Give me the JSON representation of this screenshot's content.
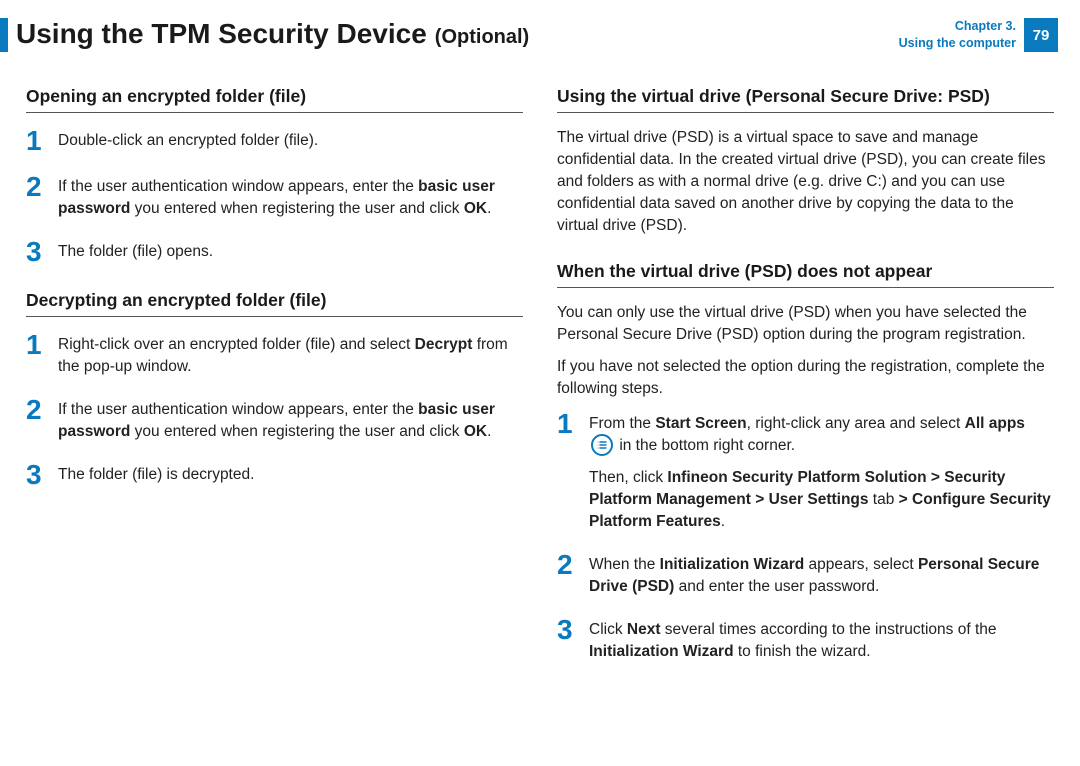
{
  "header": {
    "title": "Using the TPM Security Device",
    "optional": "(Optional)",
    "chapter_line1": "Chapter 3.",
    "chapter_line2": "Using the computer",
    "page_number": "79"
  },
  "left": {
    "sec1_heading": "Opening an encrypted folder (file)",
    "sec1_step1": "Double-click an encrypted folder (file).",
    "sec1_step2_a": "If the user authentication window appears, enter the ",
    "sec1_step2_b": "basic user password",
    "sec1_step2_c": " you entered when registering the user and click ",
    "sec1_step2_d": "OK",
    "sec1_step2_e": ".",
    "sec1_step3": "The folder (file) opens.",
    "sec2_heading": "Decrypting an encrypted folder (file)",
    "sec2_step1_a": "Right-click over an encrypted folder (file) and select ",
    "sec2_step1_b": "Decrypt",
    "sec2_step1_c": " from the pop-up window.",
    "sec2_step2_a": "If the user authentication window appears, enter the ",
    "sec2_step2_b": "basic user password",
    "sec2_step2_c": " you entered when registering the user and click ",
    "sec2_step2_d": "OK",
    "sec2_step2_e": ".",
    "sec2_step3": "The folder (file) is decrypted."
  },
  "right": {
    "sec1_heading": "Using the virtual drive (Personal Secure Drive: PSD)",
    "sec1_body": "The virtual drive (PSD) is a virtual space to save and manage confidential data. In the created virtual drive (PSD), you can create files and folders as with a normal drive (e.g. drive C:) and you can use confidential data saved on another drive by copying the data to the virtual drive (PSD).",
    "sec2_heading": "When the virtual drive (PSD) does not appear",
    "sec2_body1": "You can only use the virtual drive (PSD) when you have selected the Personal Secure Drive (PSD) option during the program registration.",
    "sec2_body2": " If you have not selected the option during the registration, complete the following steps.",
    "sec2_step1_a": "From the ",
    "sec2_step1_b": "Start Screen",
    "sec2_step1_c": ", right-click any area and select ",
    "sec2_step1_d": "All apps",
    "sec2_step1_e": " in the bottom right corner.",
    "sec2_step1_f": "Then, click ",
    "sec2_step1_g": "Infineon Security Platform Solution > Security Platform Management > User Settings",
    "sec2_step1_h": " tab ",
    "sec2_step1_i": "> Configure Security Platform Features",
    "sec2_step1_j": ".",
    "sec2_step2_a": "When the ",
    "sec2_step2_b": "Initialization Wizard",
    "sec2_step2_c": " appears, select ",
    "sec2_step2_d": "Personal Secure Drive (PSD)",
    "sec2_step2_e": " and enter the user password.",
    "sec2_step3_a": "Click ",
    "sec2_step3_b": "Next",
    "sec2_step3_c": " several times according to the instructions of the ",
    "sec2_step3_d": "Initialization Wizard",
    "sec2_step3_e": " to finish the wizard."
  },
  "nums": {
    "n1": "1",
    "n2": "2",
    "n3": "3"
  }
}
